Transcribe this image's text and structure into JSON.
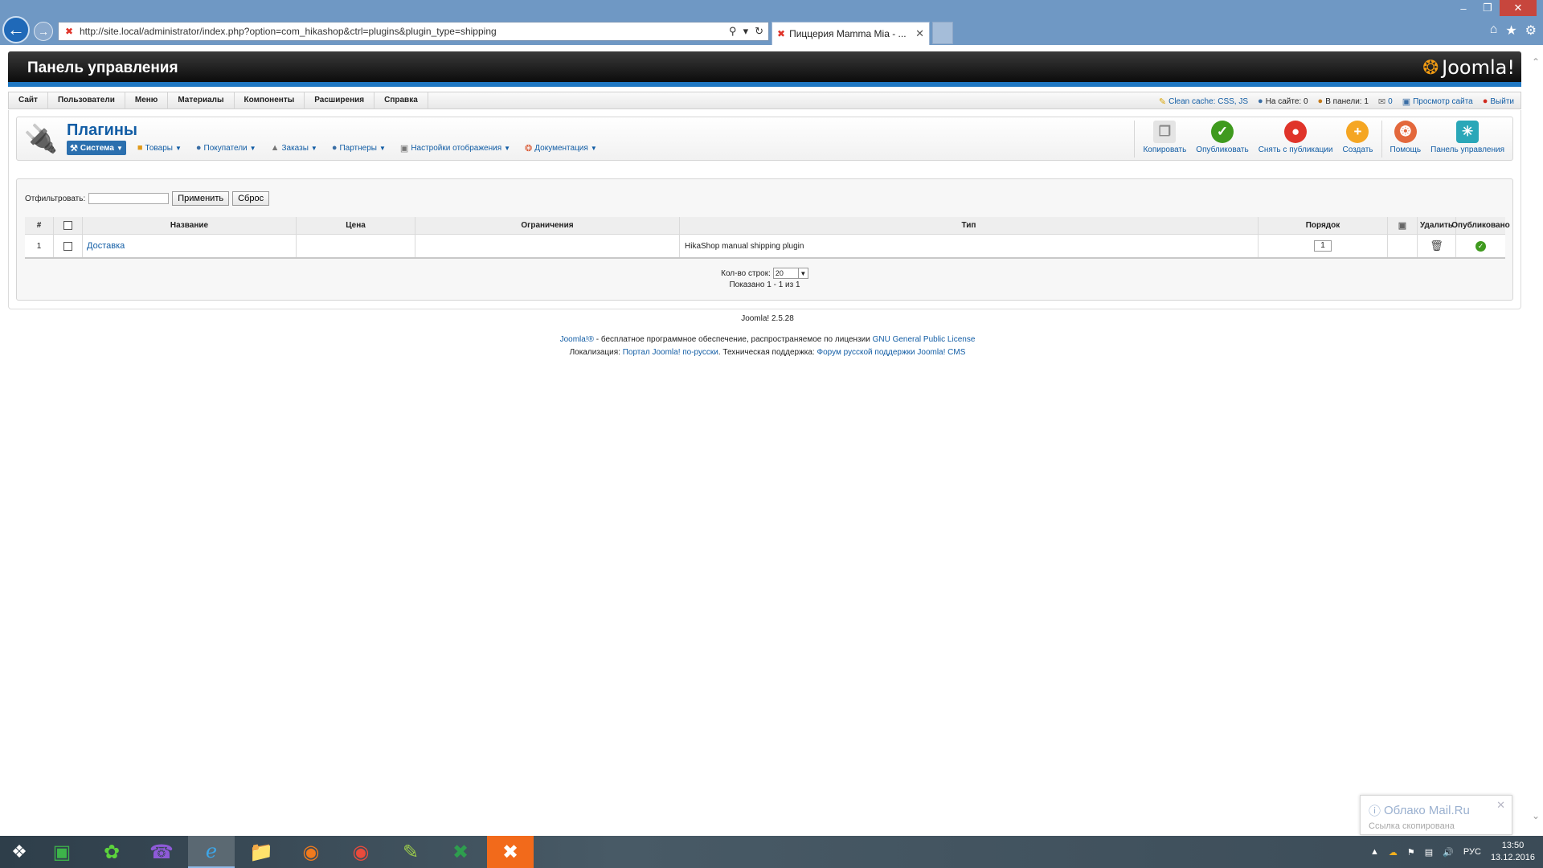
{
  "browser": {
    "url": "http://site.local/administrator/index.php?option=com_hikashop&ctrl=plugins&plugin_type=shipping",
    "tab_title": "Пиццерия Mamma Mia - ..."
  },
  "header": {
    "title": "Панель управления",
    "logo_text": "Joomla!"
  },
  "menu": {
    "items": [
      "Сайт",
      "Пользователи",
      "Меню",
      "Материалы",
      "Компоненты",
      "Расширения",
      "Справка"
    ]
  },
  "status": {
    "clean_cache": "Clean cache: CSS, JS",
    "on_site": "На сайте: 0",
    "in_panel": "В панели: 1",
    "messages": "0",
    "view_site": "Просмотр сайта",
    "logout": "Выйти"
  },
  "page": {
    "title": "Плагины",
    "submenu": [
      "Система",
      "Товары",
      "Покупатели",
      "Заказы",
      "Партнеры",
      "Настройки отображения",
      "Документация"
    ]
  },
  "toolbar": {
    "copy": "Копировать",
    "publish": "Опубликовать",
    "unpublish": "Снять с публикации",
    "create": "Создать",
    "help": "Помощь",
    "cpanel": "Панель управления"
  },
  "filter": {
    "label": "Отфильтровать:",
    "value": "",
    "apply": "Применить",
    "reset": "Сброс"
  },
  "table": {
    "headers": {
      "num": "#",
      "name": "Название",
      "price": "Цена",
      "limits": "Ограничения",
      "type": "Тип",
      "order": "Порядок",
      "delete": "Удалить",
      "published": "Опубликовано"
    },
    "rows": [
      {
        "num": "1",
        "name": "Доставка",
        "price": "",
        "limits": "",
        "type": "HikaShop manual shipping plugin",
        "order": "1",
        "published": true
      }
    ]
  },
  "pagination": {
    "rows_label": "Кол-во строк:",
    "rows_value": "20",
    "shown": "Показано 1 - 1 из 1"
  },
  "footer": {
    "version": "Joomla! 2.5.28",
    "line1_link1": "Joomla!®",
    "line1_text": " - бесплатное программное обеспечение, распространяемое по лицензии ",
    "line1_link2": "GNU General Public License",
    "line2_text1": "Локализация: ",
    "line2_link1": "Портал Joomla! по-русски",
    "line2_text2": ". Техническая поддержка: ",
    "line2_link2": "Форум русской поддержки Joomla! CMS"
  },
  "notification": {
    "title": "Облако Mail.Ru",
    "subtitle": "Ссылка скопирована"
  },
  "tray": {
    "lang": "РУС",
    "time": "13:50",
    "date": "13.12.2016"
  },
  "colors": {
    "joomla_blue": "#125da5",
    "header_stripe": "#1f77c2",
    "publish_green": "#3f9a1e",
    "unpublish_red": "#e0342a",
    "create_orange": "#f5a623"
  }
}
